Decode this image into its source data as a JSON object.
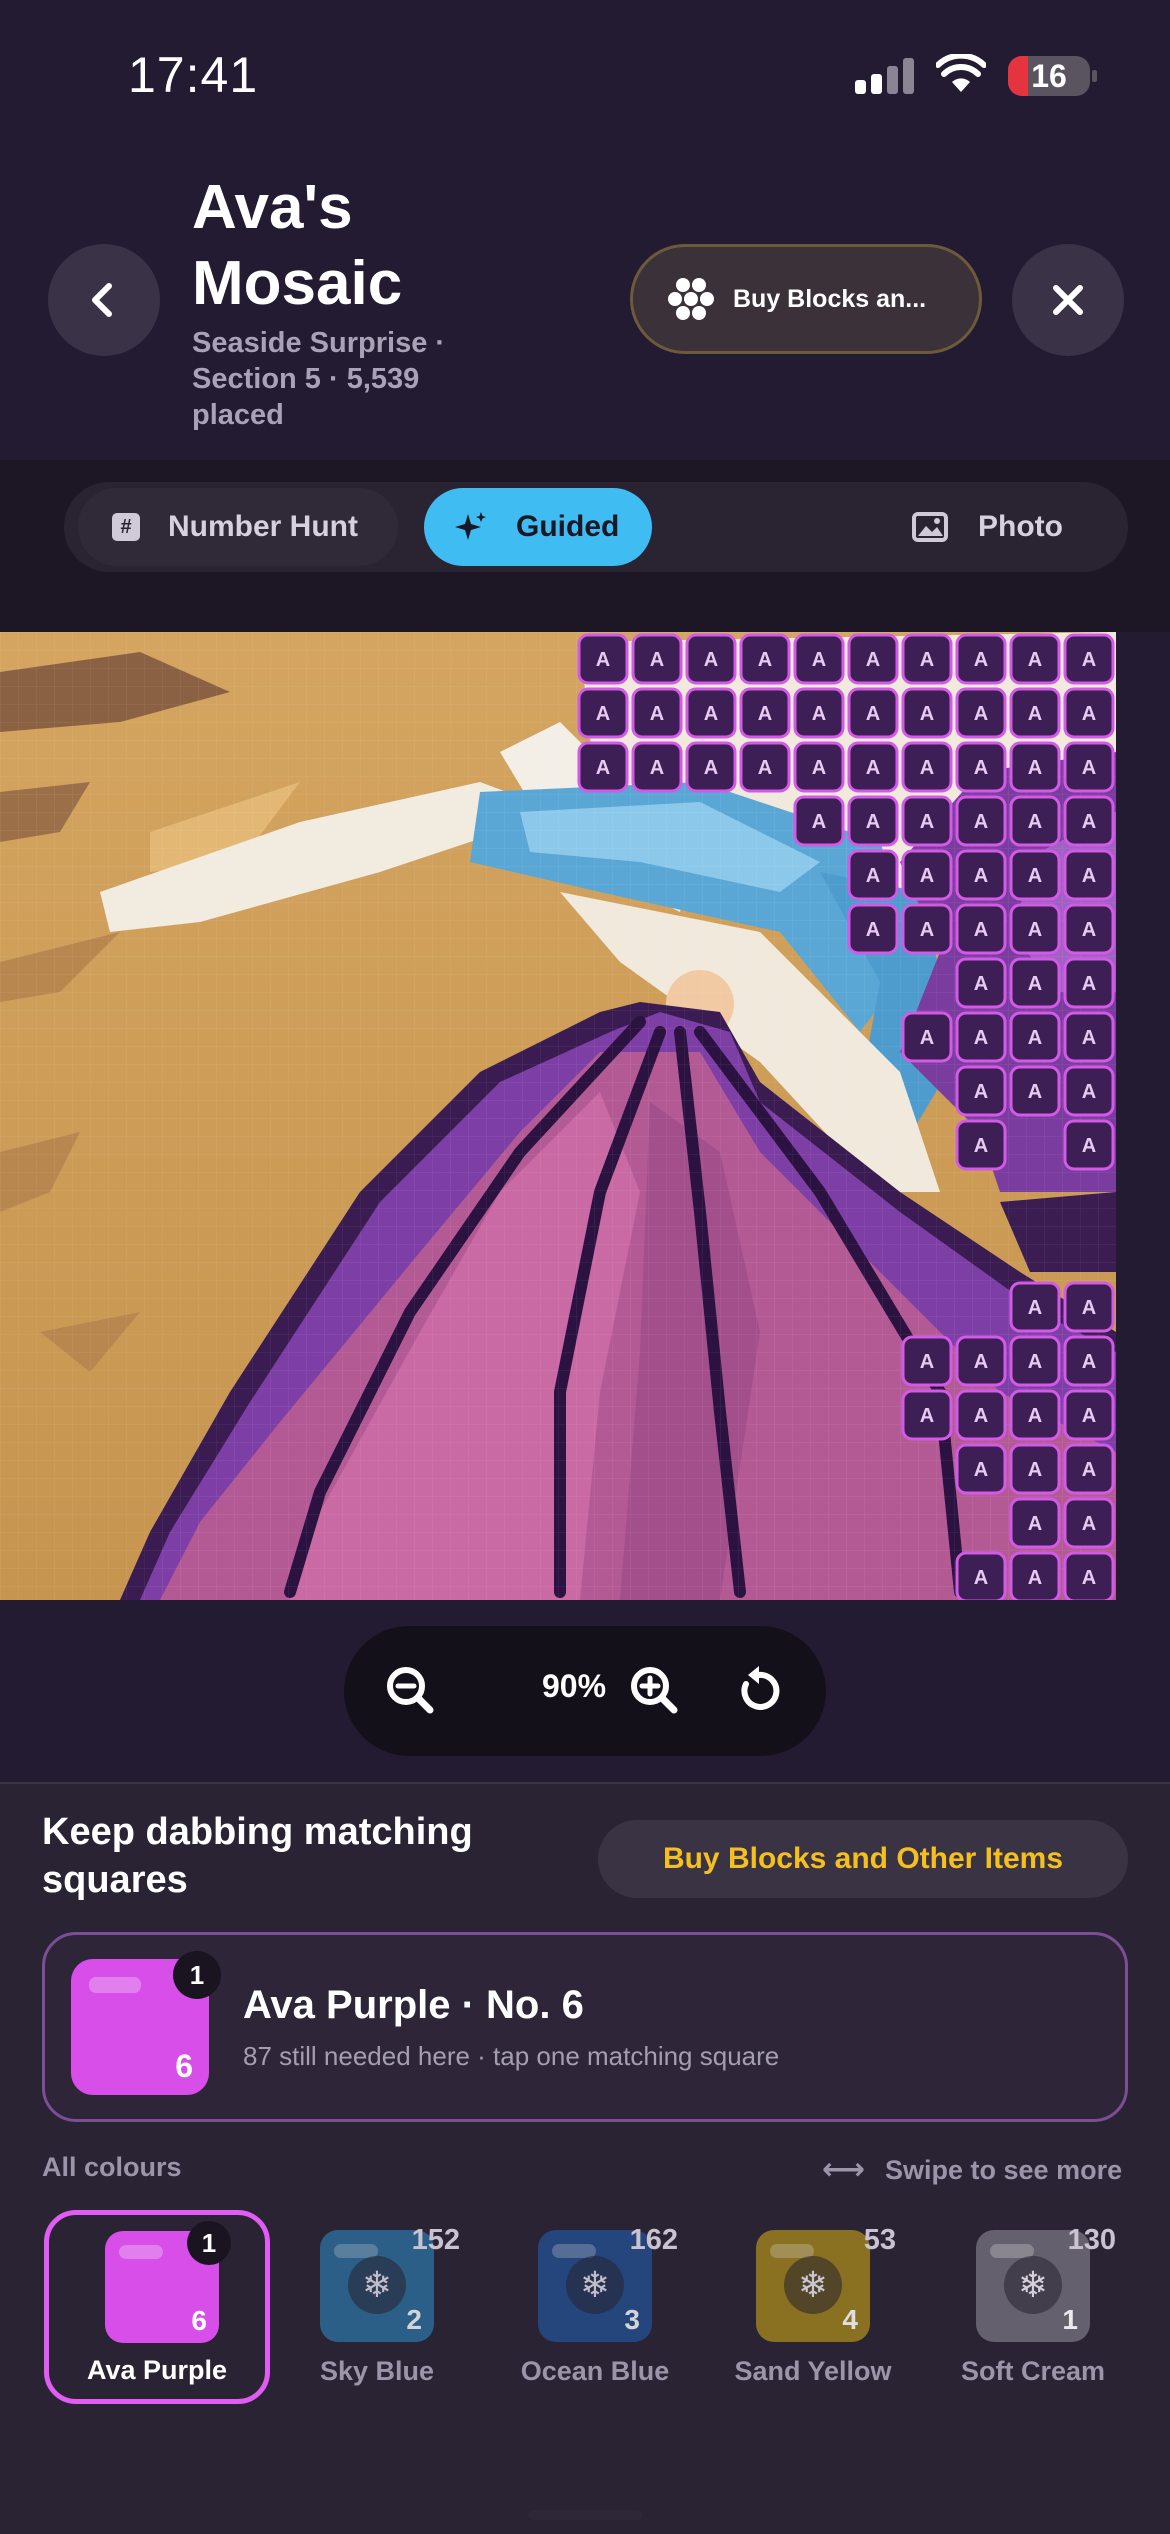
{
  "status": {
    "time": "17:41",
    "battery": "16"
  },
  "header": {
    "title": "Ava's Mosaic",
    "subtitle": "Seaside Surprise · Section 5 · 5,539 placed",
    "buy_pill": "Buy Blocks an..."
  },
  "tabs": [
    {
      "label": "Number Hunt",
      "icon": "hash-icon"
    },
    {
      "label": "Guided",
      "icon": "sparkle-icon"
    },
    {
      "label": "Photo",
      "icon": "photo-icon"
    }
  ],
  "cell_label": "A",
  "zoom": {
    "value": "90%"
  },
  "panel": {
    "heading": "Keep dabbing matching squares",
    "buy_button": "Buy Blocks and Other Items",
    "current": {
      "name": "Ava Purple · No. 6",
      "hint": "87 still needed here · tap one matching square",
      "badge": "1",
      "index": "6",
      "color": "#d74ee8"
    },
    "all_colours": "All colours",
    "swipe": "Swipe to see more",
    "palette": [
      {
        "name": "Ava Purple",
        "index": "6",
        "badge": "1",
        "color": "#d74ee8",
        "selected": true
      },
      {
        "name": "Sky Blue",
        "index": "2",
        "count": "152",
        "color": "#2d6e9c"
      },
      {
        "name": "Ocean Blue",
        "index": "3",
        "count": "162",
        "color": "#244f8e"
      },
      {
        "name": "Sand Yellow",
        "index": "4",
        "count": "53",
        "color": "#9a7f1e"
      },
      {
        "name": "Soft Cream",
        "index": "1",
        "count": "130",
        "color": "#6b6774"
      }
    ]
  }
}
